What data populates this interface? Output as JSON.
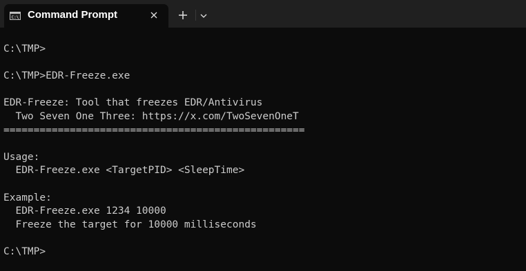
{
  "window": {
    "tab_title": "Command Prompt"
  },
  "titlebar": {
    "tab_icon": "cmd-icon",
    "close_icon": "close-icon",
    "new_tab_icon": "plus-icon",
    "dropdown_icon": "chevron-down-icon"
  },
  "colors": {
    "background": "#0c0c0c",
    "titlebar": "#202020",
    "text": "#cccccc"
  },
  "terminal": {
    "lines": [
      "C:\\TMP>",
      "",
      "C:\\TMP>EDR-Freeze.exe",
      "",
      "EDR-Freeze: Tool that freezes EDR/Antivirus",
      "  Two Seven One Three: https://x.com/TwoSevenOneT",
      "==================================================",
      "",
      "Usage:",
      "  EDR-Freeze.exe <TargetPID> <SleepTime>",
      "",
      "Example:",
      "  EDR-Freeze.exe 1234 10000",
      "  Freeze the target for 10000 milliseconds",
      "",
      "C:\\TMP>"
    ]
  }
}
